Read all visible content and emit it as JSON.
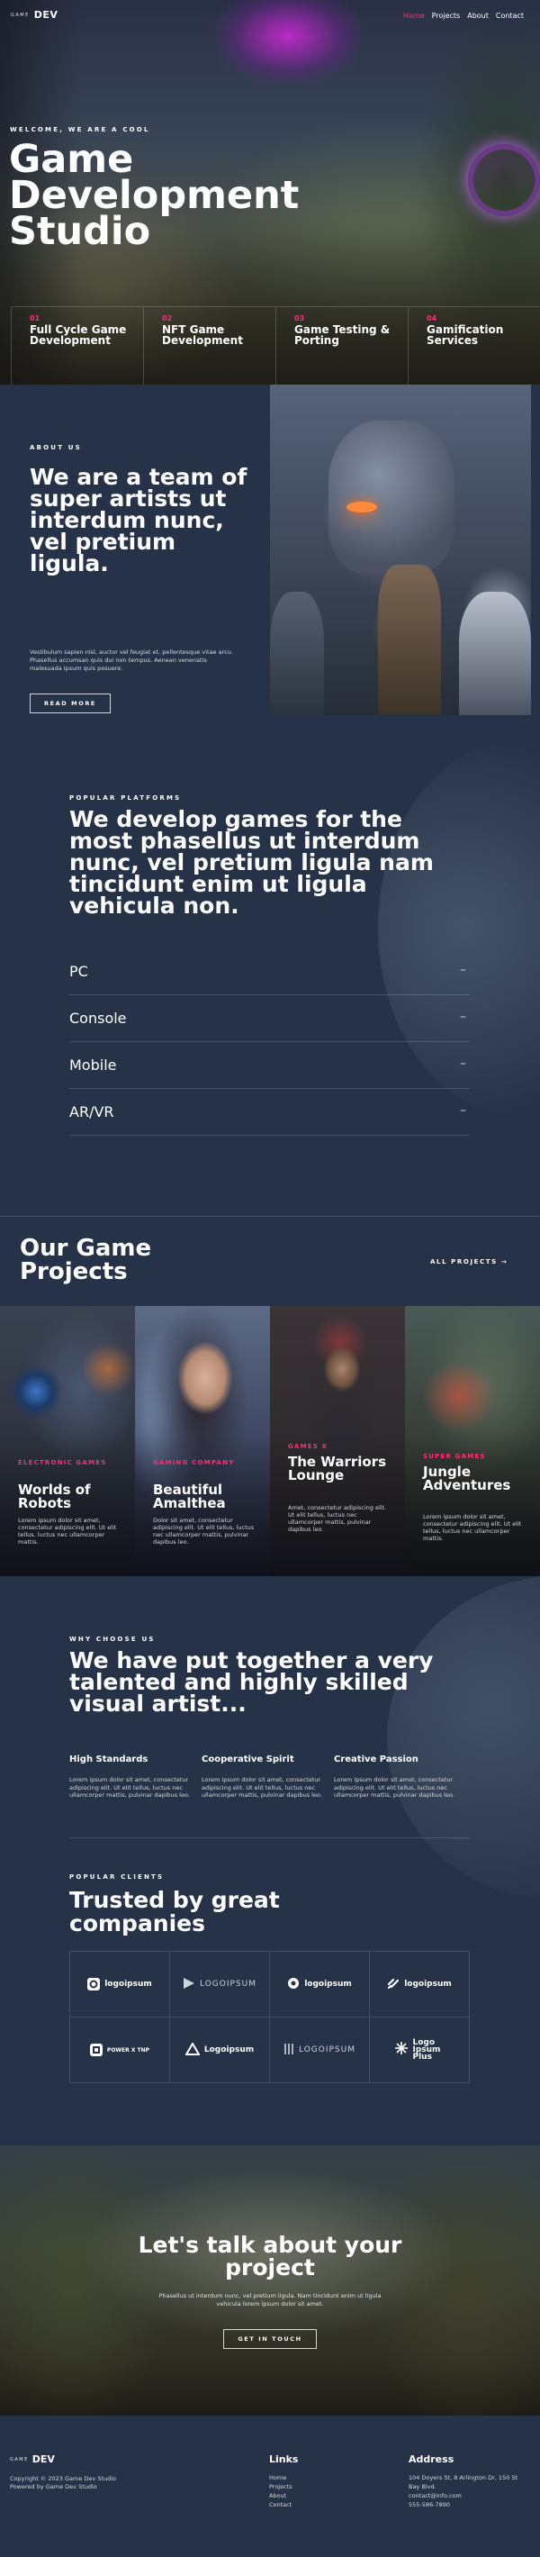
{
  "nav": {
    "logo_small": "GAME",
    "logo_large": "DEV",
    "links": [
      "Home",
      "Projects",
      "About",
      "Contact"
    ]
  },
  "hero": {
    "eyebrow": "WELCOME, WE ARE A COOL",
    "title": "Game Development Studio",
    "services": [
      {
        "num": "01",
        "label": "Full Cycle Game Development"
      },
      {
        "num": "02",
        "label": "NFT Game Development"
      },
      {
        "num": "03",
        "label": "Game Testing & Porting"
      },
      {
        "num": "04",
        "label": "Gamification Services"
      }
    ]
  },
  "about": {
    "eyebrow": "ABOUT US",
    "title": "We are a team of super artists ut interdum nunc, vel pretium ligula.",
    "body": "Vestibulum sapien nisl, auctor vel feugiat et, pellentesque vitae arcu. Phasellus accumsan quis dui non tempus. Aenean venenatis malesuada ipsum quis posuere.",
    "button": "READ MORE"
  },
  "platforms": {
    "eyebrow": "POPULAR PLATFORMS",
    "title": "We develop games for the most phasellus ut interdum nunc, vel pretium ligula nam tincidunt enim ut ligula vehicula non.",
    "items": [
      "PC",
      "Console",
      "Mobile",
      "AR/VR"
    ],
    "marker": "–"
  },
  "projects": {
    "title": "Our Game Projects",
    "all_link": "ALL PROJECTS →",
    "cards": [
      {
        "category": "ELECTRONIC GAMES",
        "title": "Worlds of Robots",
        "desc": "Lorem ipsum dolor sit amet, consectetur adipiscing elit. Ut elit tellus, luctus nec ullamcorper mattis."
      },
      {
        "category": "GAMING COMPANY",
        "title": "Beautiful Amalthea",
        "desc": "Dolor sit amet, consectetur adipiscing elit. Ut elit tellus, luctus nec ullamcorper mattis, pulvinar dapibus leo."
      },
      {
        "category": "GAMES X",
        "title": "The Warriors Lounge",
        "desc": "Amet, consectetur adipiscing elit. Ut elit tellus, luctus nec ullamcorper mattis, pulvinar dapibus leo."
      },
      {
        "category": "SUPER GAMES",
        "title": "Jungle Adventures",
        "desc": "Lorem ipsum dolor sit amet, consectetur adipiscing elit. Ut elit tellus, luctus nec ullamcorper mattis."
      }
    ]
  },
  "why": {
    "eyebrow": "WHY CHOOSE US",
    "title": "We have put together a very talented and highly skilled visual artist...",
    "features": [
      {
        "title": "High Standards",
        "desc": "Lorem ipsum dolor sit amet, consectetur adipiscing elit. Ut elit tellus, luctus nec ullamcorper mattis, pulvinar dapibus leo."
      },
      {
        "title": "Cooperative Spirit",
        "desc": "Lorem ipsum dolor sit amet, consectetur adipiscing elit. Ut elit tellus, luctus nec ullamcorper mattis, pulvinar dapibus leo."
      },
      {
        "title": "Creative Passion",
        "desc": "Lorem ipsum dolor sit amet, consectetur adipiscing elit. Ut elit tellus, luctus nec ullamcorper mattis, pulvinar dapibus leo."
      }
    ]
  },
  "clients": {
    "eyebrow": "POPULAR CLIENTS",
    "title": "Trusted by great companies",
    "logos": [
      {
        "name": "logoipsum",
        "style": "bold"
      },
      {
        "name": "LOGOIPSUM",
        "style": "light"
      },
      {
        "name": "logoipsum",
        "style": "bold"
      },
      {
        "name": "logoipsum",
        "style": "bold"
      },
      {
        "name": "POWER X TNP",
        "style": "tiny"
      },
      {
        "name": "Logoipsum",
        "style": "bold"
      },
      {
        "name": "LOGOIPSUM",
        "style": "light"
      },
      {
        "name": "Logo Ipsum Plus",
        "style": "bold"
      }
    ]
  },
  "cta": {
    "title": "Let's talk about your project",
    "body": "Phasellus ut interdum nunc, vel pretium ligula. Nam tincidunt enim ut ligula vehicula lorem ipsum dolor sit amet.",
    "button": "GET IN TOUCH"
  },
  "footer": {
    "logo_small": "GAME",
    "logo_large": "DEV",
    "copyright": "Copyright © 2023 Game Dev Studio",
    "powered": "Powered by Game Dev Studio",
    "links_title": "Links",
    "links": [
      "Home",
      "Projects",
      "About",
      "Contact"
    ],
    "address_title": "Address",
    "address": [
      "104 Doyers St, 8 Arlington Dr, 150 St",
      "Bay Blvd.",
      "contact@info.com",
      "555-586-7890"
    ]
  },
  "colors": {
    "accent": "#ff2d7a",
    "background": "#263247"
  }
}
